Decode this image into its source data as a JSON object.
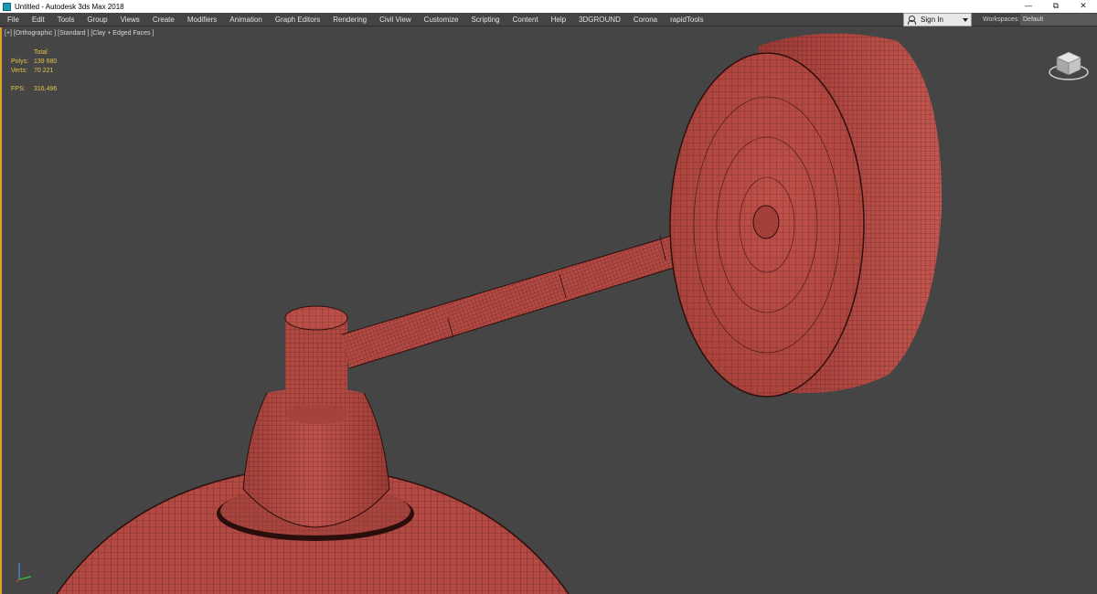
{
  "window": {
    "title": "Untitled - Autodesk 3ds Max 2018",
    "controls": [
      "minimize-icon",
      "restore-icon",
      "close-icon"
    ]
  },
  "menu": {
    "items": [
      "File",
      "Edit",
      "Tools",
      "Group",
      "Views",
      "Create",
      "Modifiers",
      "Animation",
      "Graph Editors",
      "Rendering",
      "Civil View",
      "Customize",
      "Scripting",
      "Content",
      "Help",
      "3DGROUND",
      "Corona",
      "rapidTools"
    ],
    "sign_in": "Sign In",
    "workspaces_label": "Workspaces:",
    "workspace_value": "Default"
  },
  "viewport": {
    "label": "[+] [Orthographic ] [Standard ] [Clay + Edged Faces ]",
    "stats": {
      "header": "Total",
      "polys_label": "Polys:",
      "polys_value": "139 680",
      "verts_label": "Verts:",
      "verts_value": "70 221",
      "fps_label": "FPS:",
      "fps_value": "316,496"
    }
  },
  "colors": {
    "viewport_bg": "#454545",
    "mesh": "#b54a44",
    "wire": "#3a1310",
    "stats_text": "#e5c44a",
    "active_border": "#d9a52a"
  }
}
